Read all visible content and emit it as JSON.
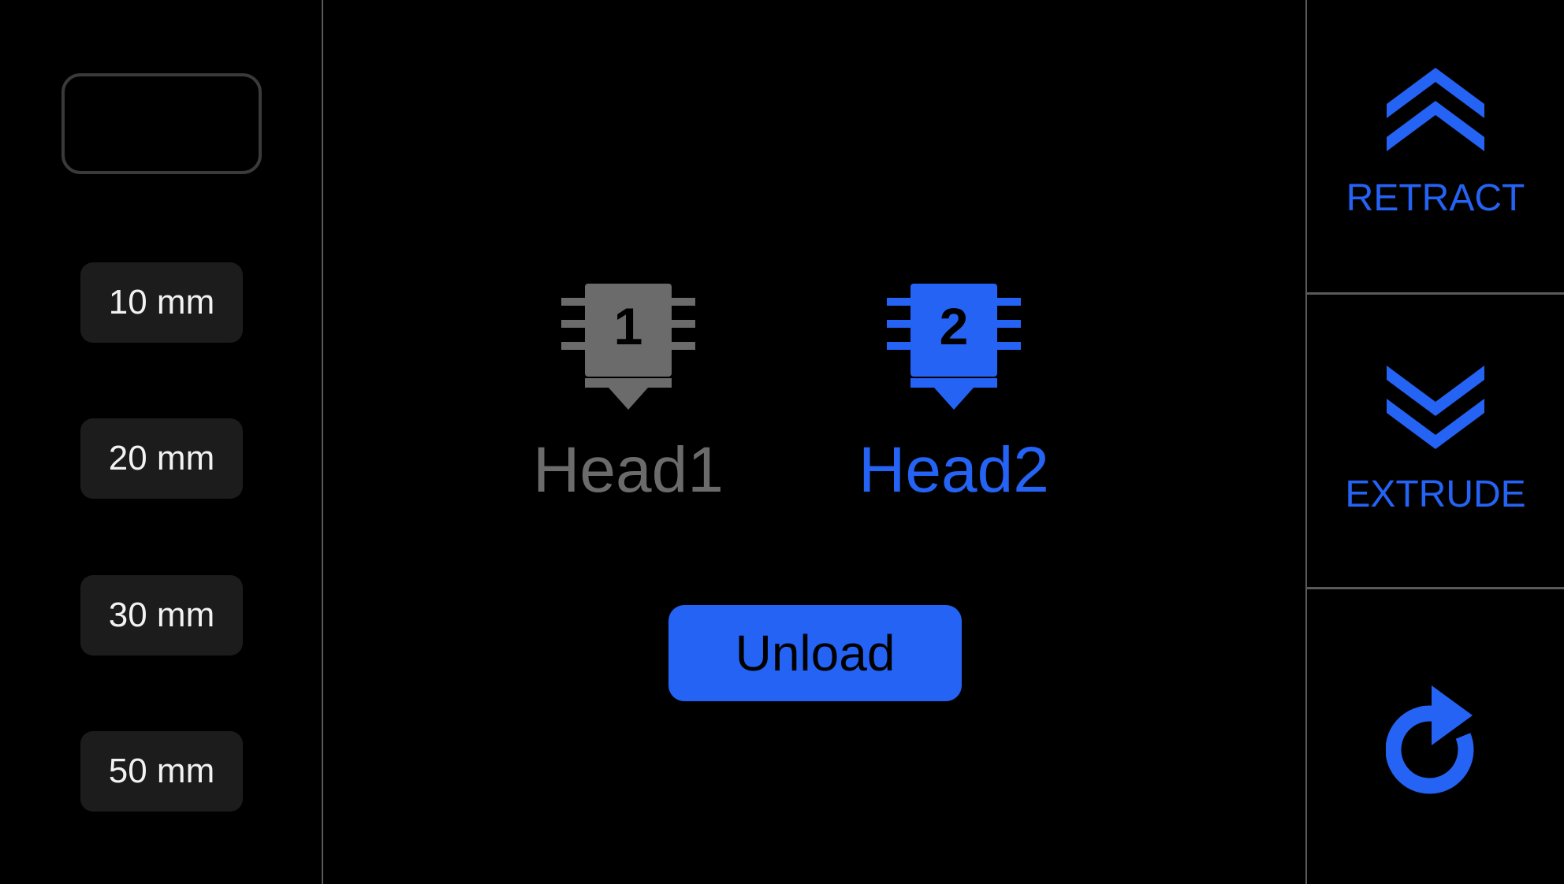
{
  "colors": {
    "background": "#000000",
    "accent": "#2563f5",
    "inactive": "#6b6b6b",
    "divider": "#5a5a5a",
    "step_button_bg": "#1c1c1c",
    "step_button_text": "#f2f2f2"
  },
  "left_panel": {
    "length_input": {
      "value": "",
      "placeholder": ""
    },
    "step_buttons": [
      {
        "label": "10 mm"
      },
      {
        "label": "20 mm"
      },
      {
        "label": "30 mm"
      },
      {
        "label": "50 mm"
      }
    ]
  },
  "center_panel": {
    "heads": [
      {
        "number": "1",
        "label": "Head1",
        "selected": false,
        "icon": "nozzle-icon"
      },
      {
        "number": "2",
        "label": "Head2",
        "selected": true,
        "icon": "nozzle-icon"
      }
    ],
    "unload_button": {
      "label": "Unload"
    }
  },
  "right_panel": {
    "retract": {
      "label": "RETRACT",
      "icon": "double-chevron-up-icon"
    },
    "extrude": {
      "label": "EXTRUDE",
      "icon": "double-chevron-down-icon"
    },
    "refresh": {
      "icon": "refresh-icon"
    }
  }
}
